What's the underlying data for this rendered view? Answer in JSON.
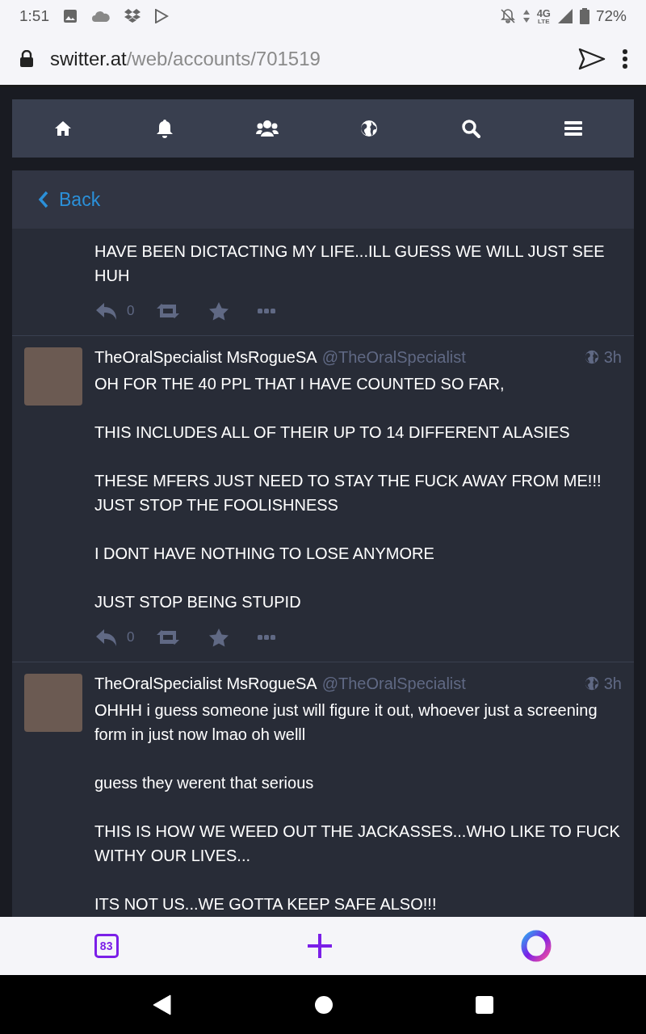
{
  "status_bar": {
    "time": "1:51",
    "network": "4G",
    "network_sub": "LTE",
    "battery": "72%"
  },
  "address_bar": {
    "host": "switter.at",
    "path": "/web/accounts/701519"
  },
  "back": {
    "label": "Back"
  },
  "posts": [
    {
      "body": [
        "HAVE BEEN DICTACTING MY LIFE...ILL GUESS WE WILL JUST SEE HUH"
      ],
      "replies": "0"
    },
    {
      "name": "TheOralSpecialist MsRogueSA",
      "handle": "@TheOralSpecialist",
      "time": "3h",
      "body": [
        "OH FOR THE 40 PPL THAT I HAVE COUNTED SO FAR,",
        "THIS INCLUDES ALL OF THEIR UP TO 14 DIFFERENT ALASIES",
        "THESE MFERS JUST NEED TO STAY THE FUCK AWAY FROM ME!!! JUST STOP THE FOOLISHNESS",
        "I DONT HAVE NOTHING TO LOSE ANYMORE",
        "JUST STOP BEING STUPID"
      ],
      "replies": "0"
    },
    {
      "name": "TheOralSpecialist MsRogueSA",
      "handle": "@TheOralSpecialist",
      "time": "3h",
      "body": [
        "OHHH i guess someone just will figure it out, whoever just a screening form in just now lmao oh welll",
        "guess they werent that serious",
        "THIS IS HOW WE WEED OUT THE JACKASSES...WHO LIKE TO FUCK WITHY OUR LIVES...",
        "ITS NOT US...WE GOTTA KEEP SAFE ALSO!!!"
      ]
    }
  ],
  "bottom_bar": {
    "tabs_count": "83"
  }
}
